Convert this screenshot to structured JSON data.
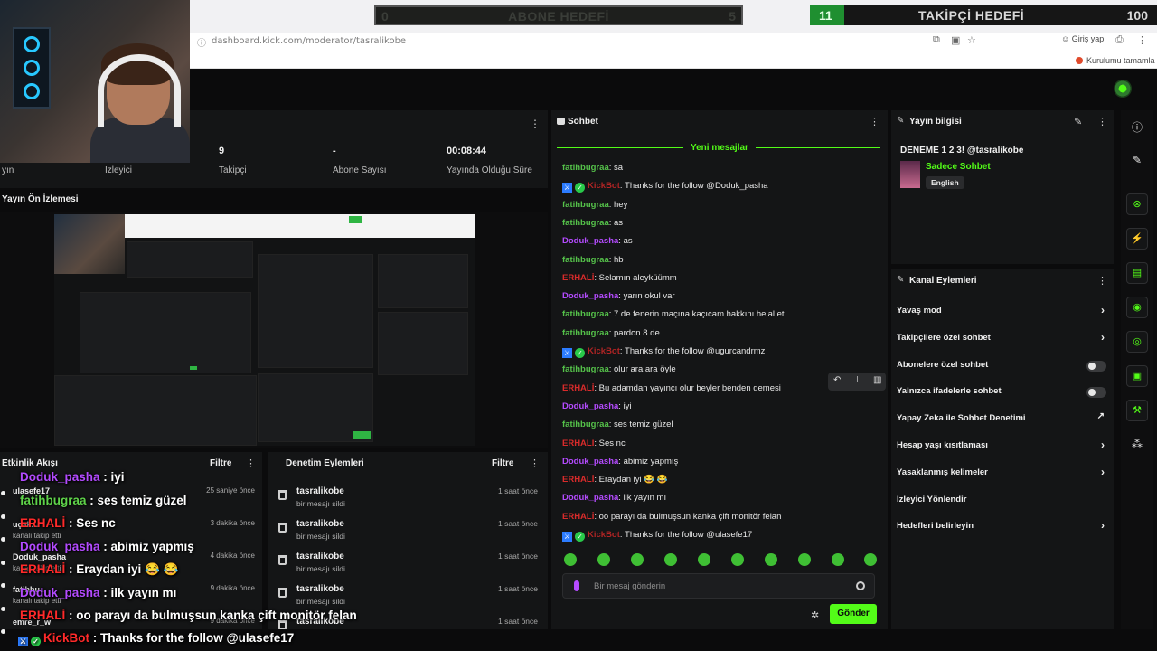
{
  "browser": {
    "url": "dashboard.kick.com/moderator/tasralikobe",
    "login_label": "Giriş yap",
    "setup_label": "Kurulumu tamamla"
  },
  "goals": {
    "subscriber_goal": {
      "left": "0",
      "label": "ABONE HEDEFİ",
      "right": "5"
    },
    "follower_goal": {
      "left": "11",
      "label": "TAKİPÇİ HEDEFİ",
      "right": "100"
    }
  },
  "stats": [
    {
      "value": "",
      "label": "yın"
    },
    {
      "value": "",
      "label": "İzleyici"
    },
    {
      "value": "9",
      "label": "Takipçi"
    },
    {
      "value": "-",
      "label": "Abone Sayısı"
    },
    {
      "value": "00:08:44",
      "label": "Yayında Olduğu Süre"
    }
  ],
  "preview": {
    "title": "Yayın Ön İzlemesi"
  },
  "activity": {
    "title": "Etkinlik Akışı",
    "filter": "Filtre",
    "items": [
      {
        "name": "ulasefe17",
        "sub": "",
        "time": "25 saniye önce"
      },
      {
        "name": "uçak...",
        "sub": "kanalı takip etti",
        "time": "3 dakika önce"
      },
      {
        "name": "Doduk_pasha",
        "sub": "kanalı takip etti",
        "time": "4 dakika önce"
      },
      {
        "name": "fatihbu...",
        "sub": "kanalı takip etti",
        "time": "9 dakika önce"
      },
      {
        "name": "emre_r_w",
        "sub": "",
        "time": "9 dakika önce"
      }
    ]
  },
  "overlay_chat": [
    {
      "user": "Doduk_pasha",
      "text": " : iyi",
      "color": "p"
    },
    {
      "user": "fatihbugraa",
      "text": " : ses temiz güzel",
      "color": "g"
    },
    {
      "user": "ERHALİ",
      "text": " : Ses nc",
      "color": "r"
    },
    {
      "user": "Doduk_pasha",
      "text": " : abimiz yapmış",
      "color": "p"
    },
    {
      "user": "ERHALİ",
      "text": " : Eraydan iyi 😂 😂",
      "color": "r"
    },
    {
      "user": "Doduk_pasha",
      "text": " : ilk yayın mı",
      "color": "p"
    },
    {
      "user": "ERHALİ",
      "text": " : oo parayı da bulmuşsun kanka çift monitör felan",
      "color": "r"
    },
    {
      "user": "KickBot",
      "text": " : Thanks for the follow @ulasefe17",
      "color": "r"
    }
  ],
  "moderation": {
    "title": "Denetim Eylemleri",
    "filter": "Filtre",
    "items": [
      {
        "user": "tasralikobe",
        "desc": "bir mesajı sildi",
        "time": "1 saat önce"
      },
      {
        "user": "tasralikobe",
        "desc": "bir mesajı sildi",
        "time": "1 saat önce"
      },
      {
        "user": "tasralikobe",
        "desc": "bir mesajı sildi",
        "time": "1 saat önce"
      },
      {
        "user": "tasralikobe",
        "desc": "bir mesajı sildi",
        "time": "1 saat önce"
      },
      {
        "user": "tasralikobe",
        "desc": "",
        "time": "1 saat önce"
      }
    ]
  },
  "chat": {
    "title": "Sohbet",
    "new_messages": "Yeni mesajlar",
    "placeholder": "Bir mesaj gönderin",
    "send": "Gönder",
    "messages": [
      {
        "user": "fatihbugraa",
        "text": ": sa",
        "c": "g",
        "bot": false
      },
      {
        "user": "KickBot",
        "text": ": Thanks for the follow @Doduk_pasha",
        "c": "b",
        "bot": true
      },
      {
        "user": "fatihbugraa",
        "text": ": hey",
        "c": "g",
        "bot": false
      },
      {
        "user": "fatihbugraa",
        "text": ": as",
        "c": "g",
        "bot": false
      },
      {
        "user": "Doduk_pasha",
        "text": ": as",
        "c": "p",
        "bot": false
      },
      {
        "user": "fatihbugraa",
        "text": ": hb",
        "c": "g",
        "bot": false
      },
      {
        "user": "ERHALİ",
        "text": ": Selamın aleyküümm",
        "c": "r",
        "bot": false
      },
      {
        "user": "Doduk_pasha",
        "text": ": yarın okul var",
        "c": "p",
        "bot": false
      },
      {
        "user": "fatihbugraa",
        "text": ": 7 de fenerin maçına kaçıcam hakkını helal et",
        "c": "g",
        "bot": false
      },
      {
        "user": "fatihbugraa",
        "text": ": pardon 8 de",
        "c": "g",
        "bot": false
      },
      {
        "user": "KickBot",
        "text": ": Thanks for the follow @ugurcandrmz",
        "c": "b",
        "bot": true
      },
      {
        "user": "fatihbugraa",
        "text": ": olur ara ara öyle",
        "c": "g",
        "bot": false
      },
      {
        "user": "ERHALİ",
        "text": ": Bu adamdan yayıncı olur beyler benden demesi",
        "c": "r",
        "bot": false
      },
      {
        "user": "Doduk_pasha",
        "text": ": iyi",
        "c": "p",
        "bot": false
      },
      {
        "user": "fatihbugraa",
        "text": ": ses temiz güzel",
        "c": "g",
        "bot": false
      },
      {
        "user": "ERHALİ",
        "text": ": Ses nc",
        "c": "r",
        "bot": false
      },
      {
        "user": "Doduk_pasha",
        "text": ": abimiz yapmış",
        "c": "p",
        "bot": false
      },
      {
        "user": "ERHALİ",
        "text": ": Eraydan iyi 😂 😂",
        "c": "r",
        "bot": false
      },
      {
        "user": "Doduk_pasha",
        "text": ": ilk yayın mı",
        "c": "p",
        "bot": false
      },
      {
        "user": "ERHALİ",
        "text": ": oo parayı da bulmuşsun kanka çift monitör felan",
        "c": "r",
        "bot": false
      },
      {
        "user": "KickBot",
        "text": ": Thanks for the follow @ulasefe17",
        "c": "b",
        "bot": true
      }
    ]
  },
  "stream_info": {
    "title": "Yayın bilgisi",
    "stream_title": "DENEME 1 2 3! @tasralikobe",
    "category": "Sadece Sohbet",
    "language": "English"
  },
  "channel_actions": {
    "title": "Kanal Eylemleri",
    "items": [
      {
        "label": "Yavaş mod",
        "control": "chevron"
      },
      {
        "label": "Takipçilere özel sohbet",
        "control": "chevron"
      },
      {
        "label": "Abonelere özel sohbet",
        "control": "toggle"
      },
      {
        "label": "Yalnızca ifadelerle sohbet",
        "control": "toggle"
      },
      {
        "label": "Yapay Zeka ile Sohbet Denetimi",
        "control": "external"
      },
      {
        "label": "Hesap yaşı kısıtlaması",
        "control": "chevron"
      },
      {
        "label": "Yasaklanmış kelimeler",
        "control": "chevron"
      },
      {
        "label": "İzleyici Yönlendir",
        "control": "none"
      },
      {
        "label": "Hedefleri belirleyin",
        "control": "chevron"
      }
    ]
  },
  "colors": {
    "accent": "#53fc18",
    "panel": "#141516",
    "background": "#0b0b0c"
  }
}
